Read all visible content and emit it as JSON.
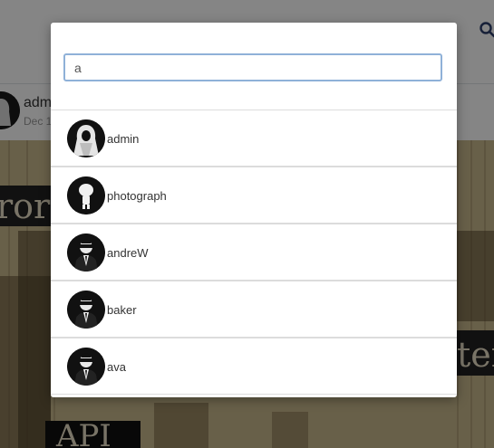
{
  "background": {
    "post_author": "adm",
    "post_date": "Dec 1",
    "image_text_left": "ror",
    "image_text_right": "ter",
    "image_text_bottom": "API"
  },
  "search": {
    "value": "a"
  },
  "results": [
    {
      "name": "admin",
      "avatar": "hooded-figure-icon"
    },
    {
      "name": "photograph",
      "avatar": "figurine-icon"
    },
    {
      "name": "andreW",
      "avatar": "man-in-suit-icon"
    },
    {
      "name": "baker",
      "avatar": "man-in-suit-icon"
    },
    {
      "name": "ava",
      "avatar": "man-in-suit-icon"
    }
  ],
  "colors": {
    "input_border": "#8fb1d8",
    "search_icon": "#2c3e6b",
    "overlay": "rgba(0,0,0,0.48)"
  }
}
